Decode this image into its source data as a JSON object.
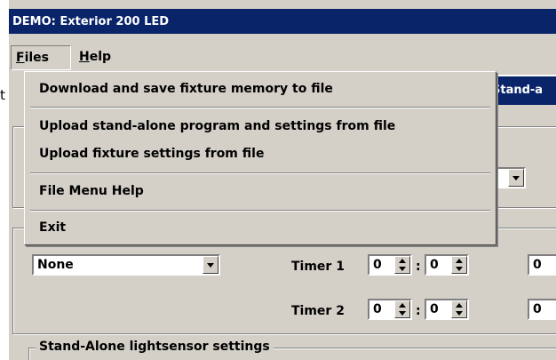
{
  "window": {
    "title": "DEMO: Exterior 200 LED"
  },
  "menubar": {
    "files": "Files",
    "files_mnemonic": "F",
    "files_rest": "iles",
    "help": "Help",
    "help_mnemonic": "H",
    "help_rest": "elp"
  },
  "files_menu": {
    "items": [
      {
        "label": "Download and save fixture memory to file"
      },
      {
        "label": "Upload stand-alone program and settings from file"
      },
      {
        "label": "Upload fixture settings from file"
      },
      {
        "label": "File Menu Help"
      },
      {
        "label": "Exit"
      }
    ]
  },
  "background": {
    "partial_text": "t",
    "tab_partial": "Stand-a",
    "effect_select": {
      "value": "None"
    },
    "timer1": {
      "label": "Timer 1",
      "hours": "0",
      "minutes": "0",
      "extra": "0"
    },
    "timer2": {
      "label": "Timer 2",
      "hours": "0",
      "minutes": "0",
      "extra": "0"
    },
    "colon": ":",
    "lightsensor_group": "Stand-Alone lightsensor settings"
  },
  "colors": {
    "titlebar": "#0a246a",
    "face": "#d4d0c8"
  }
}
